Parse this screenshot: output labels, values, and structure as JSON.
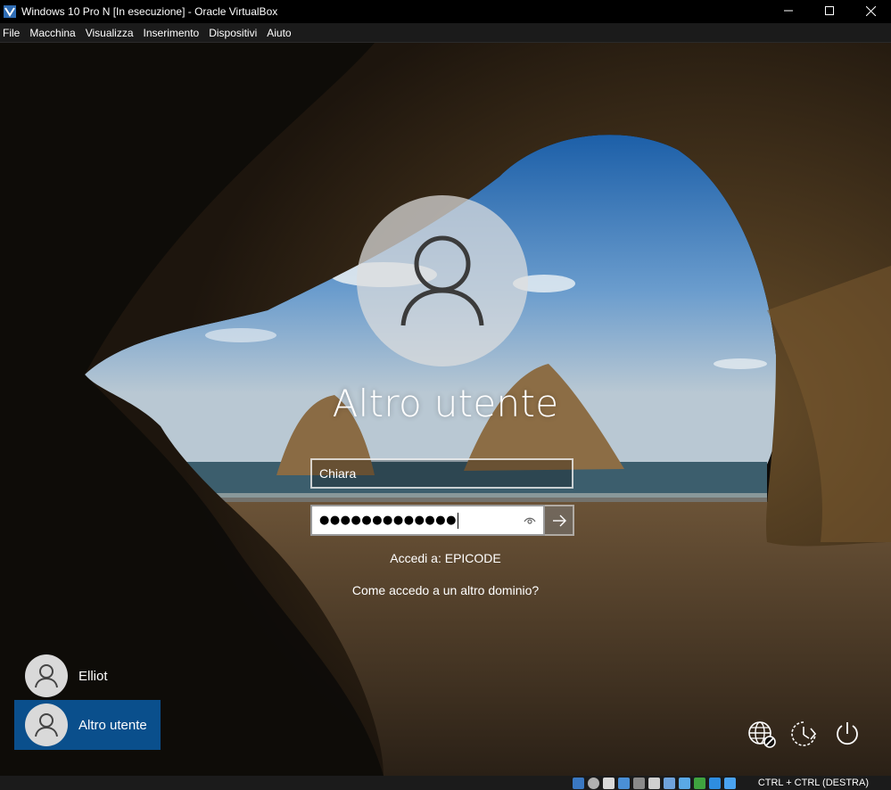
{
  "window": {
    "title": "Windows 10 Pro N [In esecuzione] - Oracle VirtualBox"
  },
  "menu": [
    "File",
    "Macchina",
    "Visualizza",
    "Inserimento",
    "Dispositivi",
    "Aiuto"
  ],
  "login": {
    "title": "Altro utente",
    "username_value": "Chiara",
    "password_mask": "●●●●●●●●●●●●●",
    "domain_text": "Accedi a: EPICODE",
    "domain_help_link": "Come accedo a un altro dominio?"
  },
  "users": [
    {
      "label": "Elliot",
      "selected": false
    },
    {
      "label": "Altro utente",
      "selected": true
    }
  ],
  "system_icons": [
    "network-icon",
    "accessibility-icon",
    "power-icon"
  ],
  "statusbar": {
    "hostkey": "CTRL + CTRL (DESTRA)"
  },
  "colors": {
    "selected_tile": "#0a4f8c",
    "titlebar": "#000000",
    "menubar": "#1b1b1b"
  }
}
